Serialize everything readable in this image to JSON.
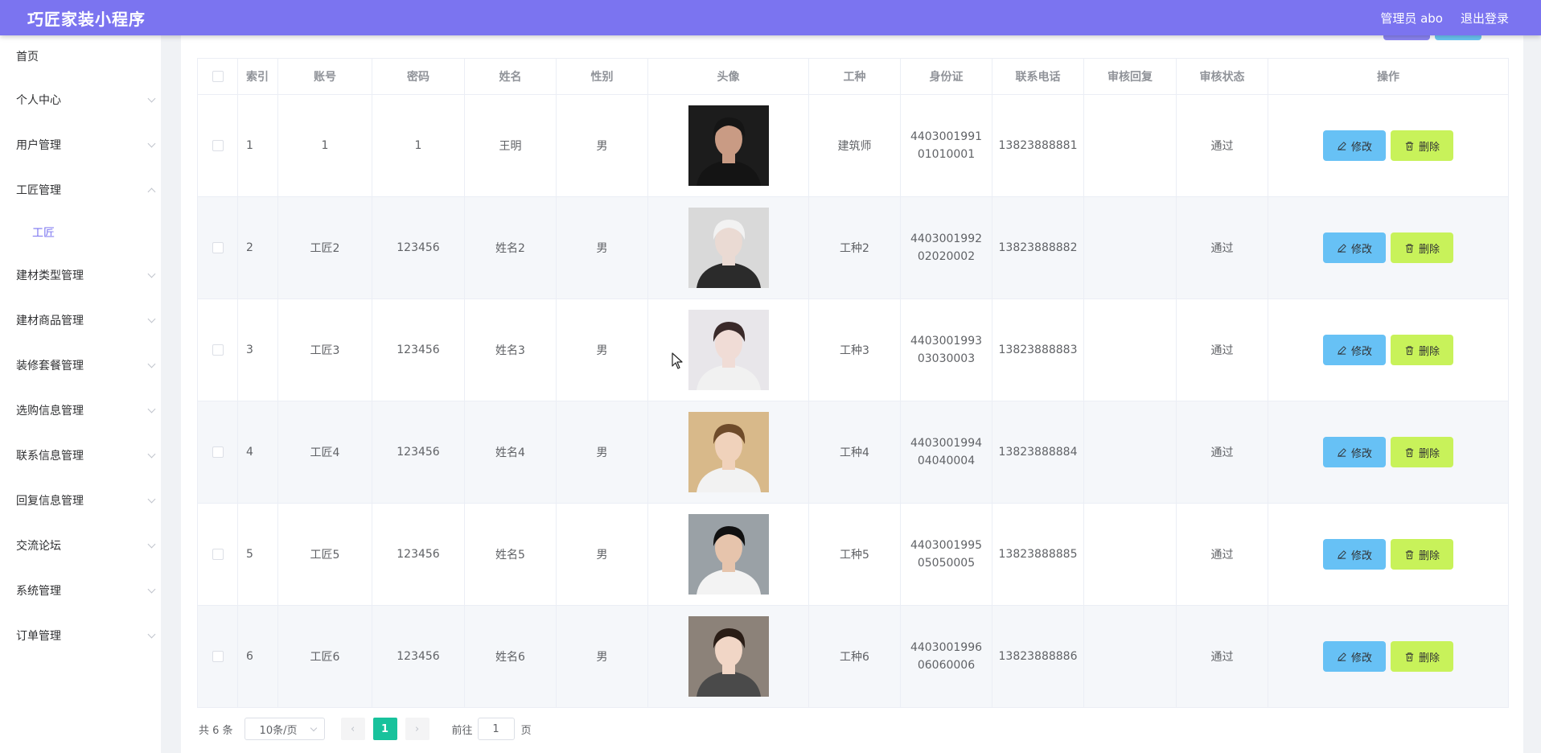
{
  "header": {
    "title": "巧匠家装小程序",
    "user_label": "管理员 abo",
    "logout_label": "退出登录",
    "color": "#7b74f0"
  },
  "sidebar": {
    "items": [
      {
        "label": "首页",
        "has_chevron": false
      },
      {
        "label": "个人中心",
        "has_chevron": true
      },
      {
        "label": "用户管理",
        "has_chevron": true
      },
      {
        "label": "工匠管理",
        "has_chevron": true,
        "expanded": true,
        "children": [
          "工匠"
        ]
      },
      {
        "label": "建材类型管理",
        "has_chevron": true
      },
      {
        "label": "建材商品管理",
        "has_chevron": true
      },
      {
        "label": "装修套餐管理",
        "has_chevron": true
      },
      {
        "label": "选购信息管理",
        "has_chevron": true
      },
      {
        "label": "联系信息管理",
        "has_chevron": true
      },
      {
        "label": "回复信息管理",
        "has_chevron": true
      },
      {
        "label": "交流论坛",
        "has_chevron": true
      },
      {
        "label": "系统管理",
        "has_chevron": true
      },
      {
        "label": "订单管理",
        "has_chevron": true
      }
    ]
  },
  "table": {
    "columns": [
      "索引",
      "账号",
      "密码",
      "姓名",
      "性别",
      "头像",
      "工种",
      "身份证",
      "联系电话",
      "审核回复",
      "审核状态",
      "操作"
    ],
    "rows": [
      {
        "index": "1",
        "account": "1",
        "password": "1",
        "name": "王明",
        "gender": "男",
        "avatar": "avatar-1",
        "job": "建筑师",
        "id_card": "440300199101010001",
        "phone": "13823888881",
        "reply": "",
        "status": "通过"
      },
      {
        "index": "2",
        "account": "工匠2",
        "password": "123456",
        "name": "姓名2",
        "gender": "男",
        "avatar": "avatar-2",
        "job": "工种2",
        "id_card": "440300199202020002",
        "phone": "13823888882",
        "reply": "",
        "status": "通过"
      },
      {
        "index": "3",
        "account": "工匠3",
        "password": "123456",
        "name": "姓名3",
        "gender": "男",
        "avatar": "avatar-3",
        "job": "工种3",
        "id_card": "440300199303030003",
        "phone": "13823888883",
        "reply": "",
        "status": "通过"
      },
      {
        "index": "4",
        "account": "工匠4",
        "password": "123456",
        "name": "姓名4",
        "gender": "男",
        "avatar": "avatar-4",
        "job": "工种4",
        "id_card": "440300199404040004",
        "phone": "13823888884",
        "reply": "",
        "status": "通过"
      },
      {
        "index": "5",
        "account": "工匠5",
        "password": "123456",
        "name": "姓名5",
        "gender": "男",
        "avatar": "avatar-5",
        "job": "工种5",
        "id_card": "440300199505050005",
        "phone": "13823888885",
        "reply": "",
        "status": "通过"
      },
      {
        "index": "6",
        "account": "工匠6",
        "password": "123456",
        "name": "姓名6",
        "gender": "男",
        "avatar": "avatar-6",
        "job": "工种6",
        "id_card": "440300199606060006",
        "phone": "13823888886",
        "reply": "",
        "status": "通过"
      }
    ],
    "actions": {
      "edit_label": "修改",
      "delete_label": "删除",
      "edit_color": "#67c1f5",
      "delete_color": "#c8f25a"
    }
  },
  "pagination": {
    "total_label": "共 6 条",
    "page_size": "10条/页",
    "current_page": "1",
    "goto_label": "前往",
    "goto_value": "1",
    "page_unit": "页",
    "active_color": "#18c29c"
  }
}
